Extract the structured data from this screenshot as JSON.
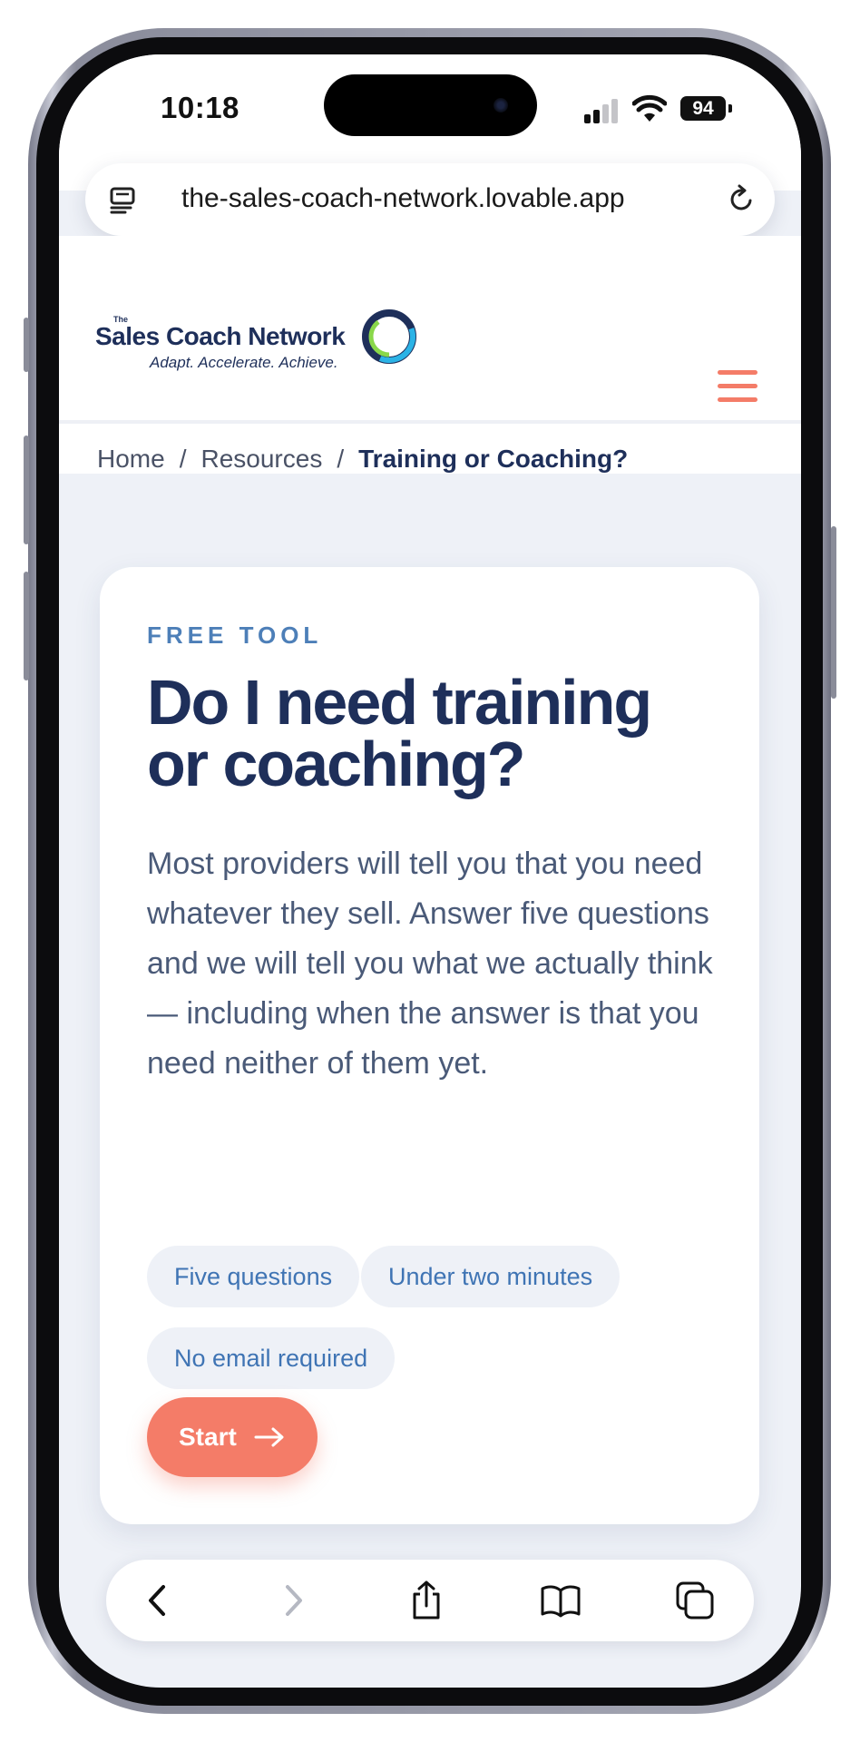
{
  "status_bar": {
    "time": "10:18",
    "battery": "94"
  },
  "browser": {
    "url": "the-sales-coach-network.lovable.app"
  },
  "site": {
    "logo": {
      "the": "The",
      "name": "Sales Coach Network",
      "tagline": "Adapt. Accelerate. Achieve."
    },
    "menu_color": "#f47c68"
  },
  "breadcrumb": {
    "home": "Home",
    "separator": "/",
    "resources": "Resources",
    "current": "Training or Coaching?"
  },
  "card": {
    "eyebrow": "FREE TOOL",
    "title": "Do I need training or coaching?",
    "description": "Most providers will tell you that you need whatever they sell. Answer five questions and we will tell you what we actually think — including when the answer is that you need neither of them yet.",
    "chips": [
      "Five questions",
      "Under two minutes",
      "No email required"
    ],
    "start_label": "Start"
  },
  "colors": {
    "brand_navy": "#1e2f5a",
    "accent_coral": "#f47c68",
    "chip_text": "#3f74b4",
    "page_bg": "#eef1f7"
  },
  "toolbar": {
    "icons": [
      "chevron-left-icon",
      "chevron-right-icon",
      "share-icon",
      "bookmarks-icon",
      "tabs-icon"
    ]
  }
}
